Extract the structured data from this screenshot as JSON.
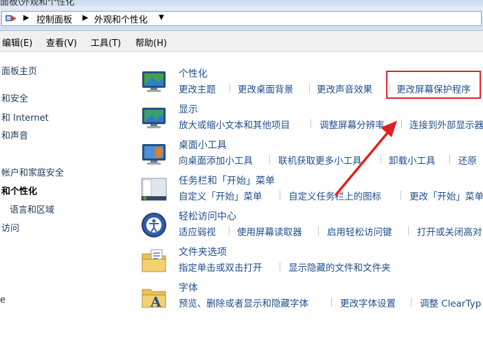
{
  "window": {
    "title": "面板\\外观和个性化"
  },
  "address": {
    "crumbs": [
      "控制面板",
      "外观和个性化"
    ]
  },
  "menu": [
    "编辑(E)",
    "查看(V)",
    "工具(T)",
    "帮助(H)"
  ],
  "sidebar": {
    "links": [
      "面板主页",
      "和安全",
      "和 Internet",
      "和声音",
      "帐户和家庭安全",
      "和个性化",
      "语言和区域",
      "访问",
      "e"
    ]
  },
  "categories": [
    {
      "title": "个性化",
      "tasks": [
        "更改主题",
        "更改桌面背景",
        "更改声音效果",
        "更改屏幕保护程序"
      ]
    },
    {
      "title": "显示",
      "tasks": [
        "放大或缩小文本和其他项目",
        "调整屏幕分辨率",
        "连接到外部显示器"
      ]
    },
    {
      "title": "桌面小工具",
      "tasks": [
        "向桌面添加小工具",
        "联机获取更多小工具",
        "卸载小工具",
        "还原"
      ]
    },
    {
      "title": "任务栏和「开始」菜单",
      "tasks": [
        "自定义「开始」菜单",
        "自定义任务栏上的图标",
        "更改「开始」菜单"
      ]
    },
    {
      "title": "轻松访问中心",
      "tasks": [
        "适应弱视",
        "使用屏幕读取器",
        "启用轻松访问键",
        "打开或关闭高对"
      ]
    },
    {
      "title": "文件夹选项",
      "tasks": [
        "指定单击或双击打开",
        "显示隐藏的文件和文件夹"
      ]
    },
    {
      "title": "字体",
      "tasks": [
        "预览、删除或者显示和隐藏字体",
        "更改字体设置",
        "调整 ClearTyp"
      ]
    }
  ],
  "colors": {
    "link": "#1e4e8c",
    "highlight": "#e02020"
  }
}
